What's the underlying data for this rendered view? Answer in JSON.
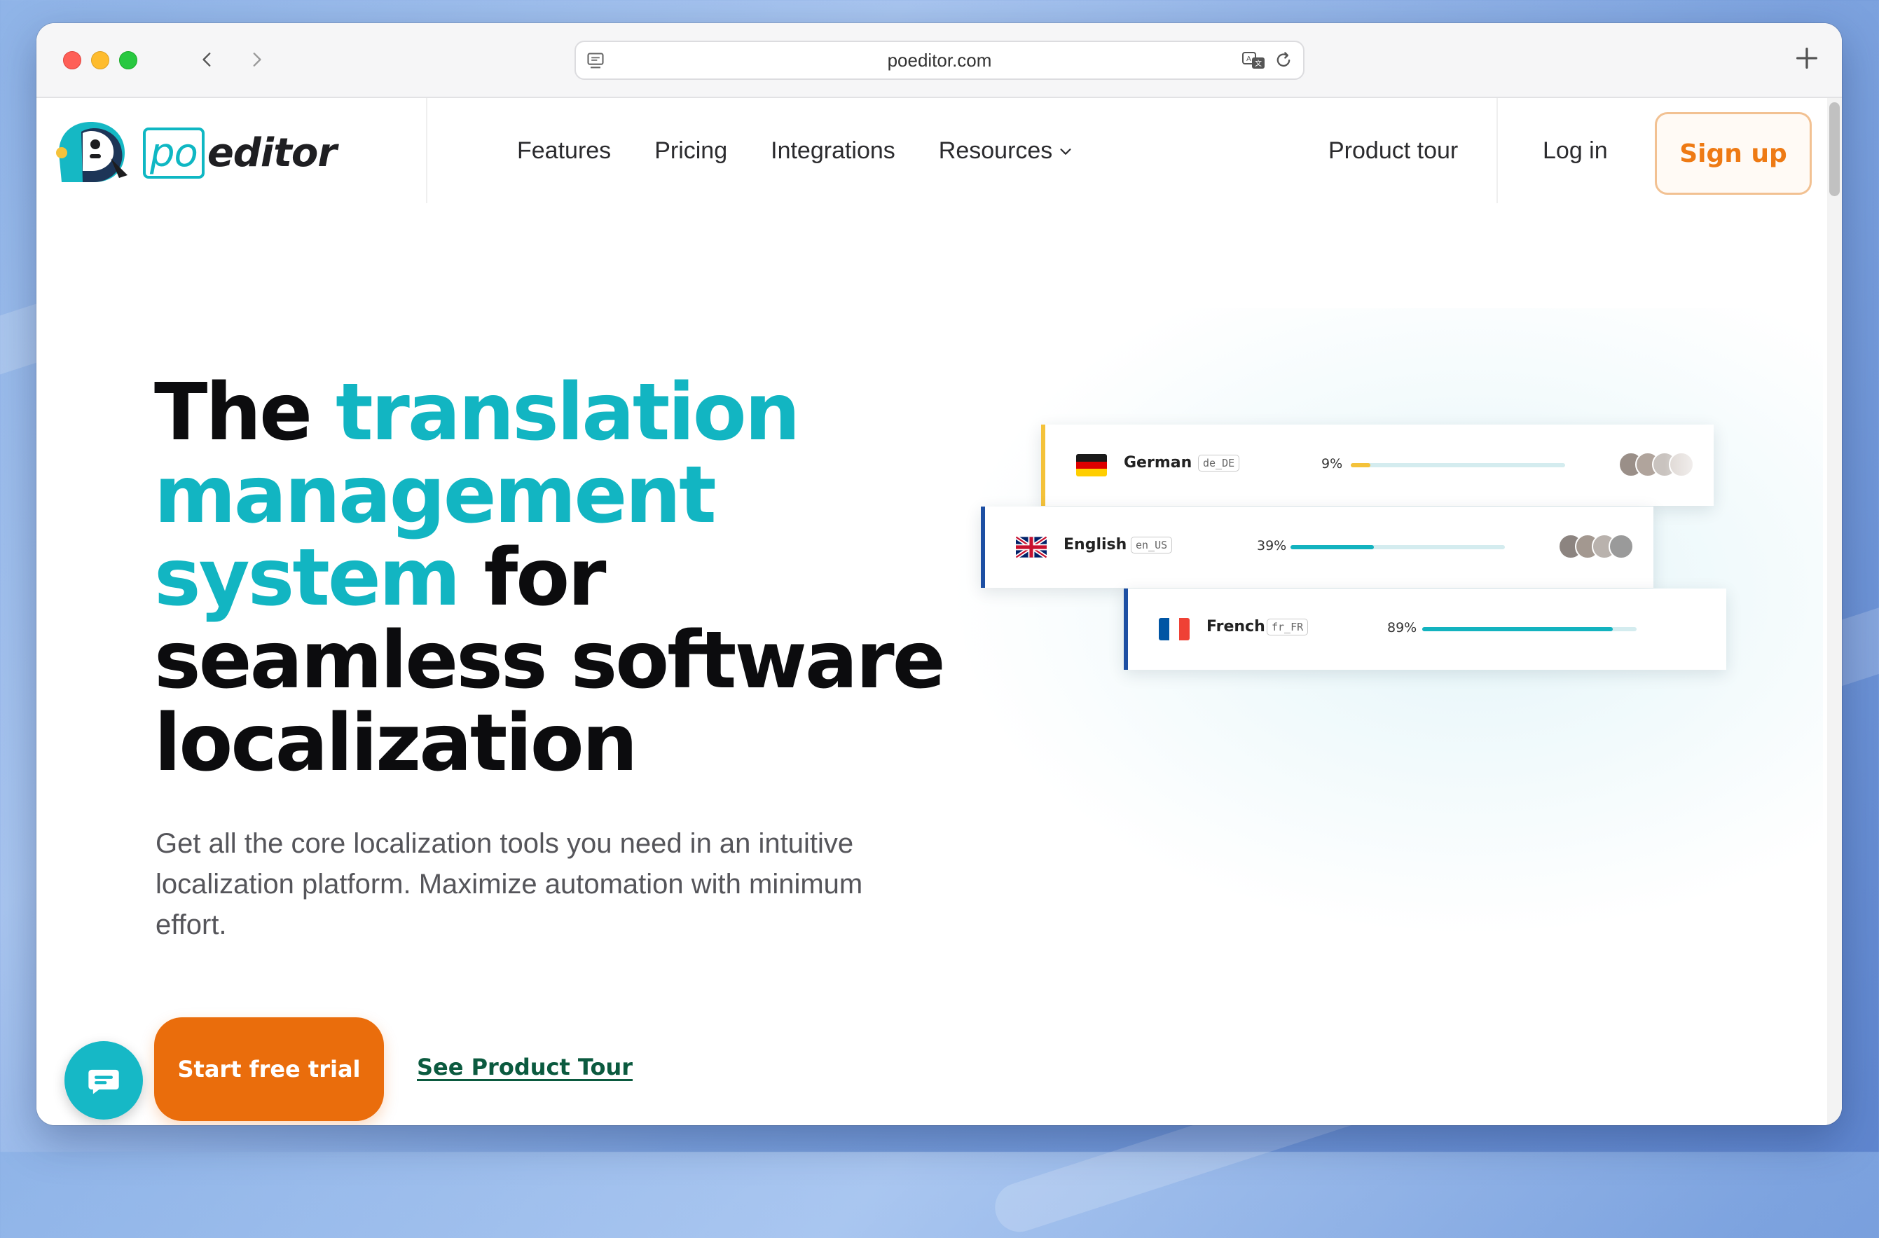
{
  "browser": {
    "url": "poeditor.com"
  },
  "header": {
    "logo_po": "po",
    "logo_editor": "editor",
    "nav": [
      {
        "label": "Features"
      },
      {
        "label": "Pricing"
      },
      {
        "label": "Integrations"
      },
      {
        "label": "Resources"
      }
    ],
    "product_tour": "Product tour",
    "login": "Log in",
    "signup": "Sign up"
  },
  "hero": {
    "title_part1": "The ",
    "title_accent": "translation management system",
    "title_part2": " for seamless software localization",
    "subtitle": "Get all the core localization tools you need in an intuitive localization platform. Maximize automation with minimum effort.",
    "cta": "Start free trial",
    "tour_link": "See Product Tour"
  },
  "languages": [
    {
      "name": "German",
      "code": "de_DE",
      "percent_label": "9%",
      "progress": 0.09,
      "accent": "#f4c23a",
      "bar_color": "#f4c23a"
    },
    {
      "name": "English",
      "code": "en_US",
      "percent_label": "39%",
      "progress": 0.39,
      "accent": "#1d4fa3",
      "bar_color": "#13b3bf"
    },
    {
      "name": "French",
      "code": "fr_FR",
      "percent_label": "89%",
      "progress": 0.89,
      "accent": "#1d4fa3",
      "bar_color": "#13b3bf"
    }
  ],
  "colors": {
    "brand_teal": "#12b5c2",
    "brand_orange": "#ea6d0c"
  }
}
